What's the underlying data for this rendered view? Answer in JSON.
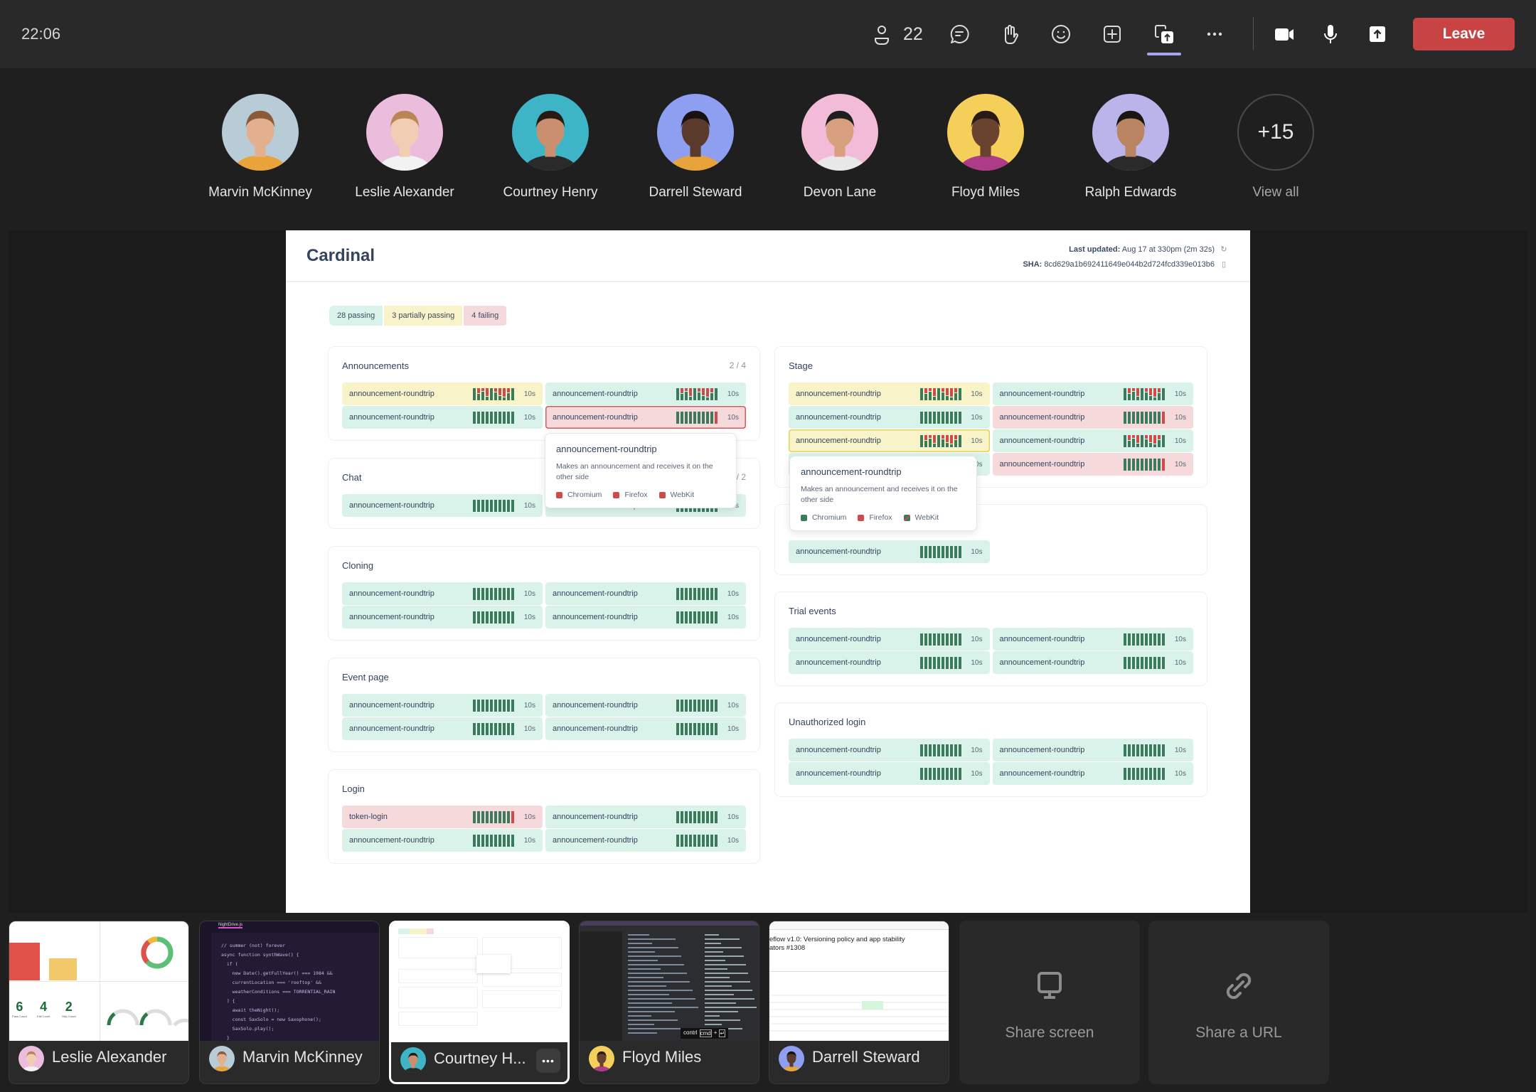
{
  "topbar": {
    "time": "22:06",
    "participants_count": "22",
    "leave_label": "Leave",
    "icons": [
      "people-icon",
      "chat-icon",
      "raise-hand-icon",
      "reactions-icon",
      "apps-icon",
      "share-content-icon",
      "more-icon",
      "camera-icon",
      "microphone-icon",
      "share-tray-icon"
    ]
  },
  "participants": [
    {
      "name": "Marvin McKinney",
      "avatar_bg": "#b8ccd8",
      "skin": "#e2b08f",
      "hair": "#8a5a3a",
      "shirt": "#e8a43a"
    },
    {
      "name": "Leslie Alexander",
      "avatar_bg": "#ecbcdc",
      "skin": "#f1cdb3",
      "hair": "#b98554",
      "shirt": "#f2f2f2"
    },
    {
      "name": "Courtney Henry",
      "avatar_bg": "#3eb5c6",
      "skin": "#c98f6e",
      "hair": "#2a1a14",
      "shirt": "#2a2a2a"
    },
    {
      "name": "Darrell Steward",
      "avatar_bg": "#8e9ef0",
      "skin": "#5a3a2a",
      "hair": "#1a1210",
      "shirt": "#e8a43a"
    },
    {
      "name": "Devon Lane",
      "avatar_bg": "#f2bcd9",
      "skin": "#d8a07e",
      "hair": "#1e1e1e",
      "shirt": "#e8e8e8"
    },
    {
      "name": "Floyd Miles",
      "avatar_bg": "#f4cf5a",
      "skin": "#6a4230",
      "hair": "#2a1a14",
      "shirt": "#b03a8a"
    },
    {
      "name": "Ralph Edwards",
      "avatar_bg": "#bbb4ea",
      "skin": "#b88462",
      "hair": "#1a1412",
      "shirt": "#2a2a2a"
    }
  ],
  "overflow": {
    "label": "+15",
    "link": "View all"
  },
  "shared_screen": {
    "app_title": "Cardinal",
    "last_updated_label": "Last updated:",
    "last_updated": "Aug 17 at 330pm (2m 32s)",
    "sha_label": "SHA:",
    "sha": "8cd629a1b692411649e044b2d724fcd339e013b6",
    "badges": [
      {
        "label": "28 passing",
        "status": "pass"
      },
      {
        "label": "3 partially passing",
        "status": "partial"
      },
      {
        "label": "4 failing",
        "status": "fail"
      }
    ],
    "columns": [
      [
        {
          "title": "Announcements",
          "count": "2 / 4",
          "cells": [
            {
              "name": "announcement-roundtrip",
              "status": "partial",
              "bars": "mixed",
              "duration": "10s"
            },
            {
              "name": "announcement-roundtrip",
              "status": "pass",
              "bars": "mixed",
              "duration": "10s"
            },
            {
              "name": "announcement-roundtrip",
              "status": "pass",
              "bars": "pass",
              "duration": "10s"
            },
            {
              "name": "announcement-roundtrip",
              "status": "fail",
              "bars": "fail",
              "duration": "10s",
              "selected": true
            }
          ]
        },
        {
          "title": "Chat",
          "count": "2 / 2",
          "cells": [
            {
              "name": "announcement-roundtrip",
              "status": "pass",
              "bars": "pass",
              "duration": "10s"
            },
            {
              "name": "announcement-roundtrip",
              "status": "pass",
              "bars": "pass",
              "duration": "10s"
            }
          ]
        },
        {
          "title": "Cloning",
          "count": "",
          "cells": [
            {
              "name": "announcement-roundtrip",
              "status": "pass",
              "bars": "pass",
              "duration": "10s"
            },
            {
              "name": "announcement-roundtrip",
              "status": "pass",
              "bars": "pass",
              "duration": "10s"
            },
            {
              "name": "announcement-roundtrip",
              "status": "pass",
              "bars": "pass",
              "duration": "10s"
            },
            {
              "name": "announcement-roundtrip",
              "status": "pass",
              "bars": "pass",
              "duration": "10s"
            }
          ]
        },
        {
          "title": "Event page",
          "count": "",
          "cells": [
            {
              "name": "announcement-roundtrip",
              "status": "pass",
              "bars": "pass",
              "duration": "10s"
            },
            {
              "name": "announcement-roundtrip",
              "status": "pass",
              "bars": "pass",
              "duration": "10s"
            },
            {
              "name": "announcement-roundtrip",
              "status": "pass",
              "bars": "pass",
              "duration": "10s"
            },
            {
              "name": "announcement-roundtrip",
              "status": "pass",
              "bars": "pass",
              "duration": "10s"
            }
          ]
        },
        {
          "title": "Login",
          "count": "",
          "cells": [
            {
              "name": "token-login",
              "status": "fail",
              "bars": "fail",
              "duration": "10s"
            },
            {
              "name": "announcement-roundtrip",
              "status": "pass",
              "bars": "pass",
              "duration": "10s"
            },
            {
              "name": "announcement-roundtrip",
              "status": "pass",
              "bars": "pass",
              "duration": "10s"
            },
            {
              "name": "announcement-roundtrip",
              "status": "pass",
              "bars": "pass",
              "duration": "10s"
            }
          ]
        }
      ],
      [
        {
          "title": "Stage",
          "count": "",
          "cells": [
            {
              "name": "announcement-roundtrip",
              "status": "partial",
              "bars": "mixed",
              "duration": "10s"
            },
            {
              "name": "announcement-roundtrip",
              "status": "pass",
              "bars": "mixed",
              "duration": "10s"
            },
            {
              "name": "announcement-roundtrip",
              "status": "pass",
              "bars": "pass",
              "duration": "10s"
            },
            {
              "name": "announcement-roundtrip",
              "status": "fail",
              "bars": "fail",
              "duration": "10s"
            },
            {
              "name": "announcement-roundtrip",
              "status": "partial",
              "bars": "mixed",
              "duration": "10s",
              "selected": true
            },
            {
              "name": "announcement-roundtrip",
              "status": "pass",
              "bars": "mixed",
              "duration": "10s"
            },
            {
              "name": "announcement-roundtrip",
              "status": "pass",
              "bars": "pass",
              "duration": "10s"
            },
            {
              "name": "announcement-roundtrip",
              "status": "fail",
              "bars": "fail",
              "duration": "10s"
            }
          ]
        },
        {
          "title": "",
          "count": "",
          "cells": [
            {
              "name": "announcement-roundtrip",
              "status": "pass",
              "bars": "pass",
              "duration": "10s"
            }
          ]
        },
        {
          "title": "Trial events",
          "count": "",
          "cells": [
            {
              "name": "announcement-roundtrip",
              "status": "pass",
              "bars": "pass",
              "duration": "10s"
            },
            {
              "name": "announcement-roundtrip",
              "status": "pass",
              "bars": "pass",
              "duration": "10s"
            },
            {
              "name": "announcement-roundtrip",
              "status": "pass",
              "bars": "pass",
              "duration": "10s"
            },
            {
              "name": "announcement-roundtrip",
              "status": "pass",
              "bars": "pass",
              "duration": "10s"
            }
          ]
        },
        {
          "title": "Unauthorized login",
          "count": "",
          "cells": [
            {
              "name": "announcement-roundtrip",
              "status": "pass",
              "bars": "pass",
              "duration": "10s"
            },
            {
              "name": "announcement-roundtrip",
              "status": "pass",
              "bars": "pass",
              "duration": "10s"
            },
            {
              "name": "announcement-roundtrip",
              "status": "pass",
              "bars": "pass",
              "duration": "10s"
            },
            {
              "name": "announcement-roundtrip",
              "status": "pass",
              "bars": "pass",
              "duration": "10s"
            }
          ]
        }
      ]
    ],
    "tooltips": [
      {
        "title": "announcement-roundtrip",
        "description": "Makes an announcement and receives it on the other side",
        "legend": [
          {
            "label": "Chromium",
            "status": "fail"
          },
          {
            "label": "Firefox",
            "status": "fail"
          },
          {
            "label": "WebKit",
            "status": "fail"
          }
        ]
      },
      {
        "title": "announcement-roundtrip",
        "description": "Makes an announcement and receives it on the other side",
        "legend": [
          {
            "label": "Chromium",
            "status": "pass"
          },
          {
            "label": "Firefox",
            "status": "fail"
          },
          {
            "label": "WebKit",
            "status": "mixed"
          }
        ]
      }
    ]
  },
  "tiles": [
    {
      "name": "Leslie Alexander",
      "preview": "dashboard",
      "avatar": 1,
      "stats": [
        {
          "value": "6",
          "label": "Pass Count"
        },
        {
          "value": "4",
          "label": "Fail Count"
        },
        {
          "value": "2",
          "label": "Skip Count"
        }
      ]
    },
    {
      "name": "Marvin McKinney",
      "preview": "code",
      "avatar": 0,
      "tab": "NightDrive.js",
      "code": [
        "// summer (not) forever",
        "async function synthWave() {",
        "  if (",
        "    new Date().getFullYear() === 1984 &&",
        "    currentLocation === 'rooftop' &&",
        "    weatherConditions === TORRENTIAL_RAIN",
        "  ) {",
        "    await theNight();",
        "    const SaxSolo = new Saxophone();",
        "    SaxSolo.play();",
        "  }",
        "}"
      ]
    },
    {
      "name": "Courtney H...",
      "preview": "cardinal",
      "avatar": 2,
      "active": true
    },
    {
      "name": "Floyd Miles",
      "preview": "editor",
      "avatar": 5,
      "keys": [
        "contrl",
        "cmd",
        "+",
        "↵"
      ]
    },
    {
      "name": "Darrell Steward",
      "preview": "github",
      "avatar": 3,
      "title_lines": [
        "eflow v1.0: Versioning policy and app stability",
        "ators #1308"
      ]
    }
  ],
  "share_actions": [
    {
      "label": "Share screen",
      "icon": "monitor-icon"
    },
    {
      "label": "Share a URL",
      "icon": "link-icon"
    }
  ],
  "colors": {
    "leave": "#c84444",
    "pass_bg": "#daf3ea",
    "partial_bg": "#f8f3c9",
    "fail_bg": "#f6d9db",
    "bar_pass": "#3c7a5c",
    "bar_fail": "#cc4b4b",
    "active_indicator": "#a6a6f0"
  }
}
